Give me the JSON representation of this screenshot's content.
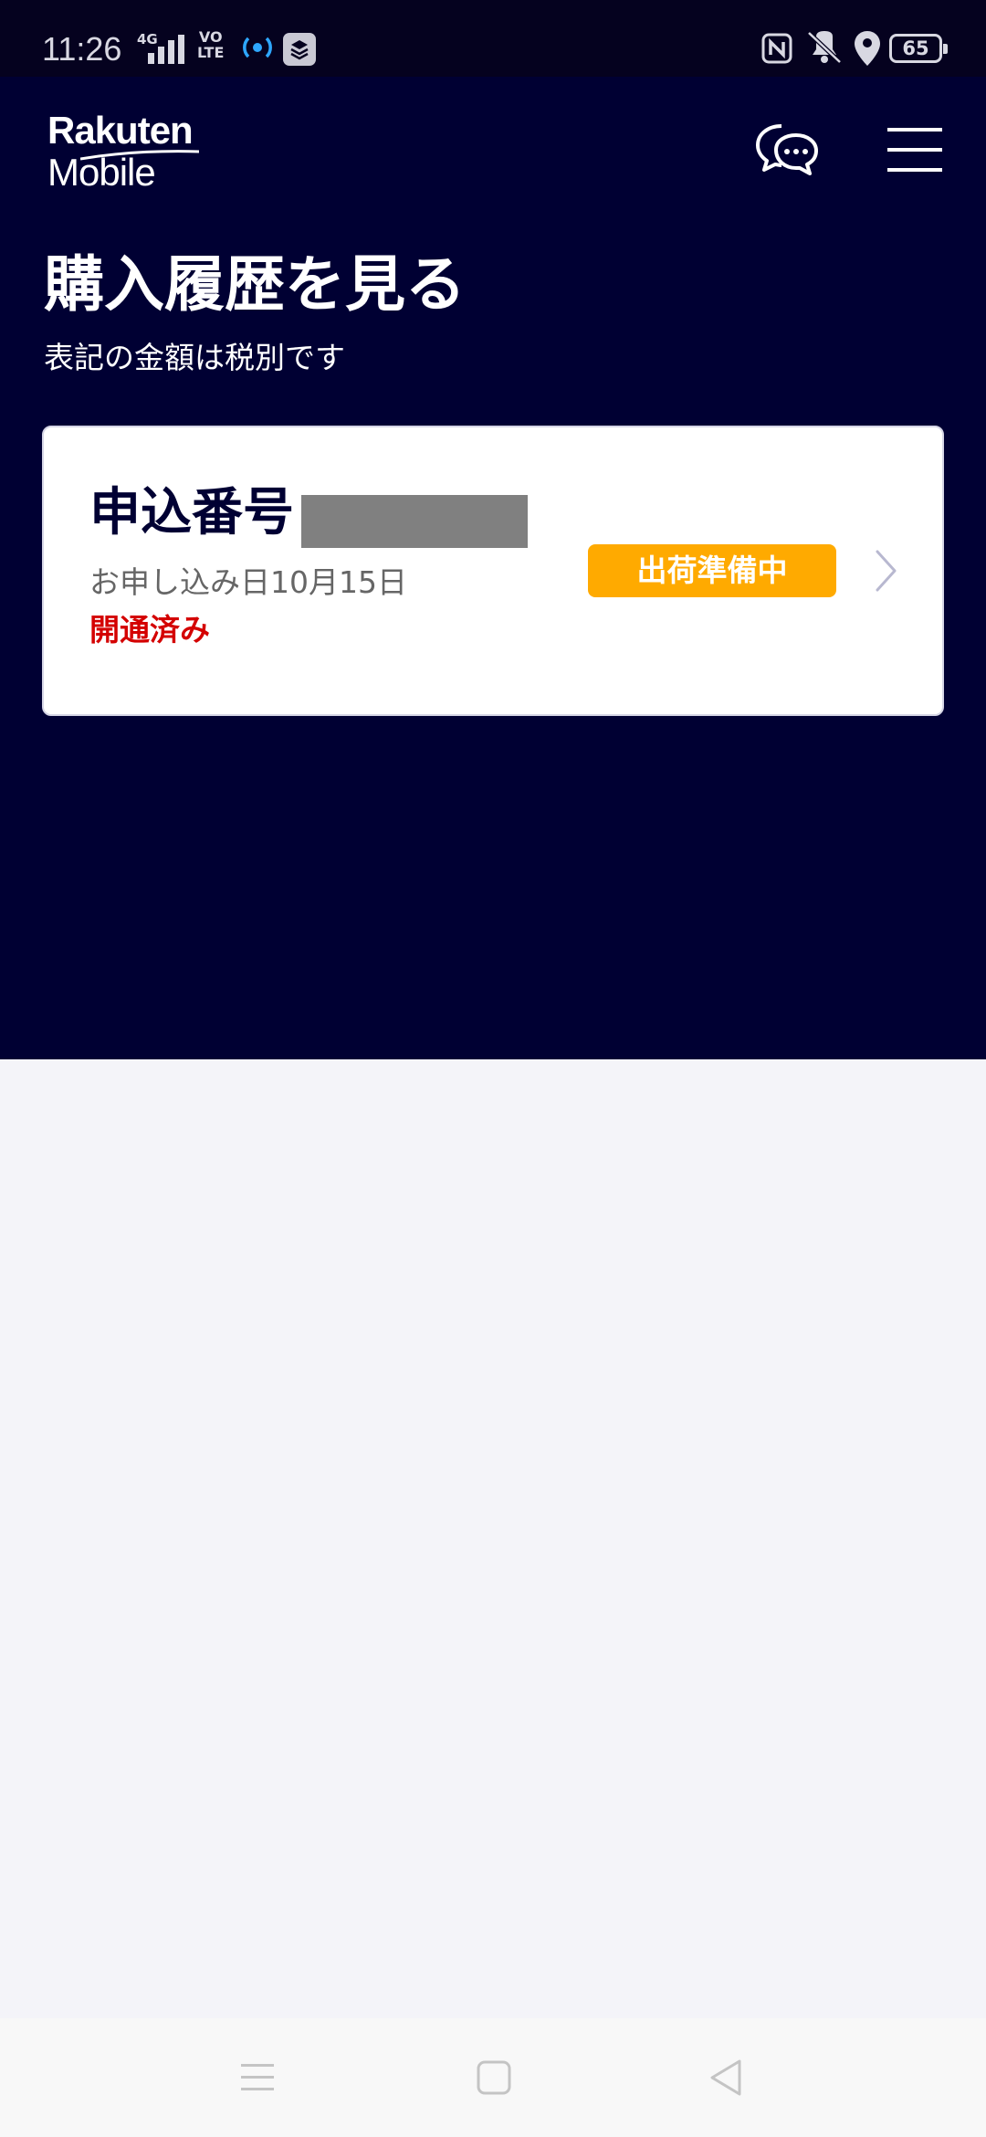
{
  "status_bar": {
    "time": "11:26",
    "network": "4G",
    "volte_top": "VO",
    "volte_bottom": "LTE",
    "battery": "65",
    "icons": [
      "signal-icon",
      "hotspot-icon",
      "app-notification-icon",
      "nfc-icon",
      "vibrate-off-icon",
      "location-icon",
      "battery-icon"
    ]
  },
  "header": {
    "brand_top": "Rakuten",
    "brand_bottom": "Mobile",
    "chat_icon": "chat-icon",
    "menu_icon": "hamburger-menu-icon"
  },
  "page": {
    "title": "購入履歴を見る",
    "subtitle": "表記の金額は税別です"
  },
  "order": {
    "number_label": "申込番号",
    "date": "お申し込み日10月15日",
    "activation_status": "開通済み",
    "shipping_status": "出荷準備中",
    "chevron_icon": "chevron-right-icon"
  },
  "nav_bar": {
    "icons": [
      "recent-apps-icon",
      "home-icon",
      "back-icon"
    ]
  },
  "colors": {
    "header_bg": "#000033",
    "status_bg": "#05021f",
    "page_bg": "#f4f4f9",
    "badge": "#ffaa00",
    "activation_red": "#d40000"
  }
}
